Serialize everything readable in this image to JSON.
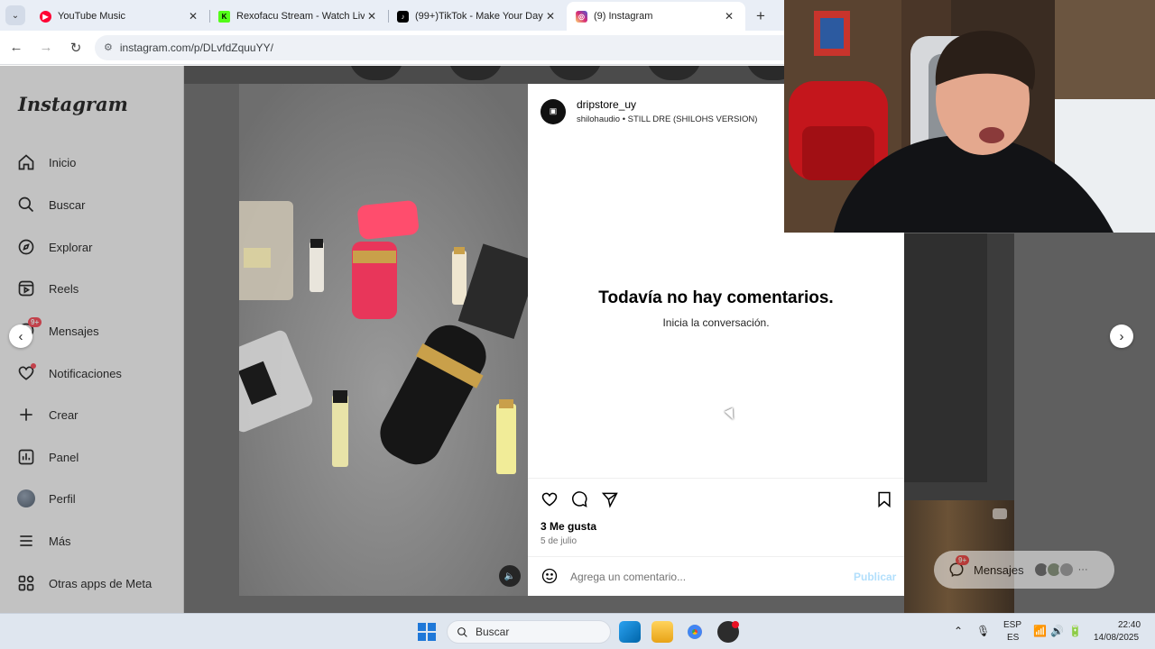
{
  "browser": {
    "tabs": [
      {
        "title": "YouTube Music",
        "icon": "youtube-music-icon",
        "color": "#ff0033",
        "active": false
      },
      {
        "title": "Rexofacu Stream - Watch Live o",
        "icon": "kick-icon",
        "color": "#53fc18",
        "active": false
      },
      {
        "title": "(99+)TikTok - Make Your Day",
        "icon": "tiktok-icon",
        "color": "#000000",
        "active": false
      },
      {
        "title": "(9) Instagram",
        "icon": "instagram-icon",
        "color": "#d62976",
        "active": true
      }
    ],
    "url": "instagram.com/p/DLvfdZquuYY/"
  },
  "sidebar": {
    "logo": "Instagram",
    "items": [
      {
        "label": "Inicio",
        "icon": "home-icon"
      },
      {
        "label": "Buscar",
        "icon": "search-icon"
      },
      {
        "label": "Explorar",
        "icon": "compass-icon"
      },
      {
        "label": "Reels",
        "icon": "reels-icon"
      },
      {
        "label": "Mensajes",
        "icon": "messenger-icon",
        "badge": "9+"
      },
      {
        "label": "Notificaciones",
        "icon": "heart-icon"
      },
      {
        "label": "Crear",
        "icon": "plus-icon"
      },
      {
        "label": "Panel",
        "icon": "dashboard-icon"
      },
      {
        "label": "Perfil",
        "icon": "profile-avatar"
      },
      {
        "label": "Más",
        "icon": "menu-icon"
      },
      {
        "label": "Otras apps de Meta",
        "icon": "meta-apps-icon"
      }
    ]
  },
  "post": {
    "username": "dripstore_uy",
    "audio": "shilohaudio • STILL DRE (SHILOHS VERSION)",
    "no_comments_title": "Todavía no hay comentarios.",
    "no_comments_sub": "Inicia la conversación.",
    "likes": "3 Me gusta",
    "date": "5 de julio",
    "comment_placeholder": "Agrega un comentario...",
    "publish_label": "Publicar"
  },
  "messages_pill": {
    "label": "Mensajes",
    "badge": "9+"
  },
  "taskbar": {
    "search_label": "Buscar",
    "lang_top": "ESP",
    "lang_bottom": "ES",
    "time": "22:40",
    "date": "14/08/2025"
  }
}
